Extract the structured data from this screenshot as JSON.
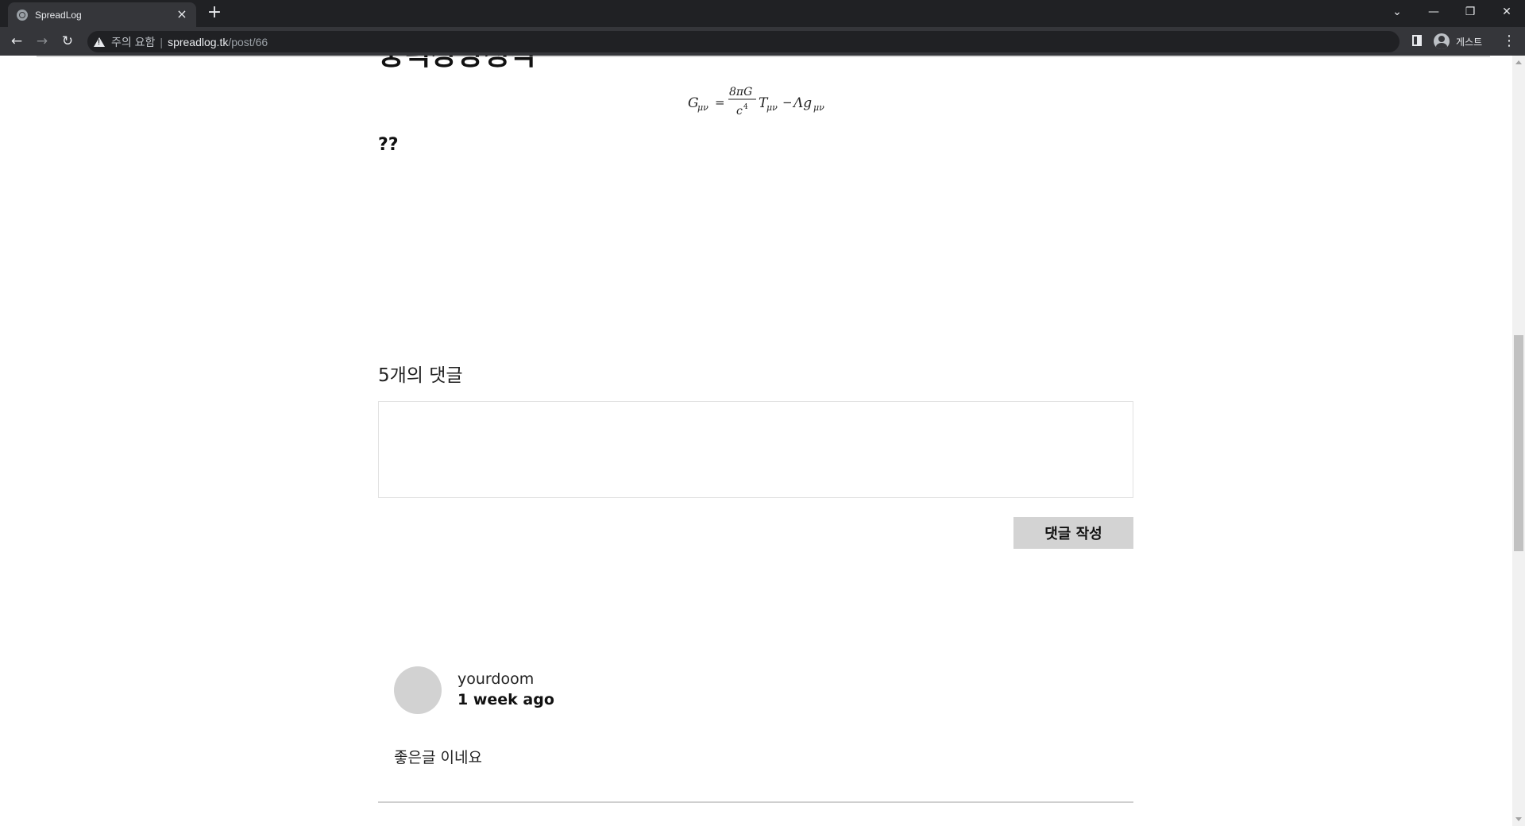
{
  "browser": {
    "tab_title": "SpreadLog",
    "tab_close": "×",
    "new_tab": "+",
    "window_controls": {
      "dropdown": "⌄",
      "minimize": "—",
      "restore": "❐",
      "close": "✕"
    },
    "back": "←",
    "forward": "→",
    "reload": "↻",
    "security_text": "주의 요함",
    "separator": "|",
    "url_host": "spreadlog.tk",
    "url_path": "/post/66",
    "profile_label": "게스트",
    "menu": "⋮"
  },
  "post": {
    "heading_partial": "중력장방정식",
    "formula": {
      "G": "G",
      "G_sub": "μν",
      "eq": "=",
      "num": "8πG",
      "den": "c",
      "den_sup": "4",
      "T": "T",
      "T_sub": "μν",
      "minus": "−",
      "lambda_g": "Λg",
      "g_sub": "μν"
    },
    "body_text": "??"
  },
  "comments": {
    "count_label": "5개의 댓글",
    "textarea_placeholder": "",
    "submit_label": "댓글 작성",
    "items": [
      {
        "author": "yourdoom",
        "time": "1 week ago",
        "body": "좋은글 이네요"
      }
    ]
  }
}
